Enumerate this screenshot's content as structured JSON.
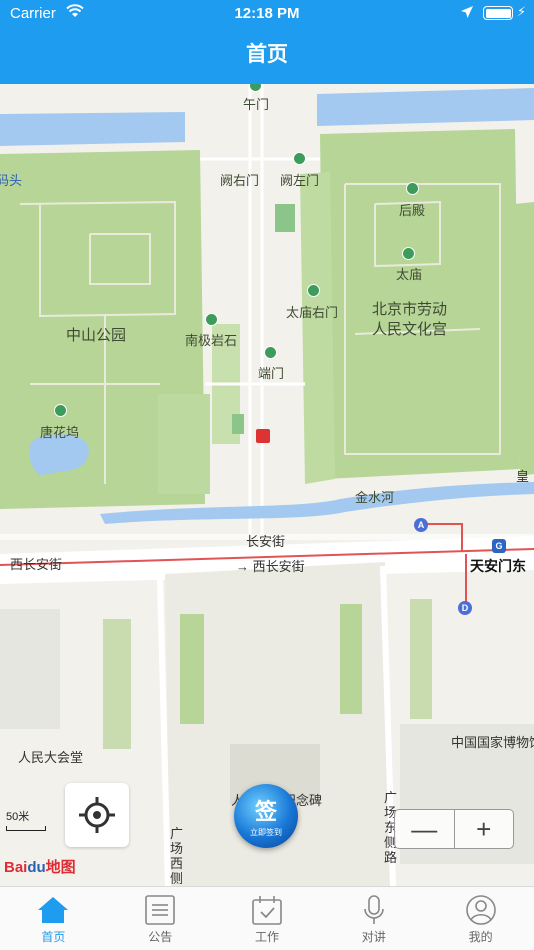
{
  "status_bar": {
    "carrier": "Carrier",
    "time": "12:18 PM",
    "battery_level": 1.0
  },
  "nav": {
    "title": "首页"
  },
  "map": {
    "labels": {
      "wumen": "午门",
      "queyoumen": "阙右门",
      "quezuomen": "阙左门",
      "houdian": "后殿",
      "taimiao": "太庙",
      "taimiao_youmen": "太庙右门",
      "laodong_1": "北京市劳动",
      "laodong_2": "人民文化宫",
      "zhongshan": "中山公园",
      "nanjiyanshi": "南极岩石",
      "duanmen": "端门",
      "tanghuawu": "唐花坞",
      "jinshuihe": "金水河",
      "changanjie": "长安街",
      "xichangan_road": "西长安街",
      "xichangan_dir": "→ 西长安街",
      "tiananmen_dong": "天安门东",
      "renmin_dahuitang": "人民大会堂",
      "national_museum": "中国国家博物馆",
      "monument": "人民英雄纪念碑",
      "guangchang_xi": "广场西侧路",
      "guangchang_dong": "广场东侧路",
      "boat_dock": "游船码头",
      "huang": "皇"
    },
    "scale_label": "50米",
    "logo_bai": "Bai",
    "logo_du": "du",
    "logo_map": "地图",
    "sign_button": {
      "main": "签",
      "sub": "立即签到"
    },
    "zoom_out": "—",
    "zoom_in": "+",
    "metro_letters": {
      "a": "A",
      "d": "D",
      "line": "G"
    }
  },
  "tabs": [
    {
      "label": "首页",
      "icon": "home-icon",
      "active": true
    },
    {
      "label": "公告",
      "icon": "notice-icon",
      "active": false
    },
    {
      "label": "工作",
      "icon": "calendar-icon",
      "active": false
    },
    {
      "label": "对讲",
      "icon": "microphone-icon",
      "active": false
    },
    {
      "label": "我的",
      "icon": "user-icon",
      "active": false
    }
  ],
  "colors": {
    "brand": "#1e9cf0",
    "park": "#b6d597",
    "water": "#a3c9f0",
    "tab_active": "#1e9cf0",
    "tab_inactive": "#888888"
  }
}
